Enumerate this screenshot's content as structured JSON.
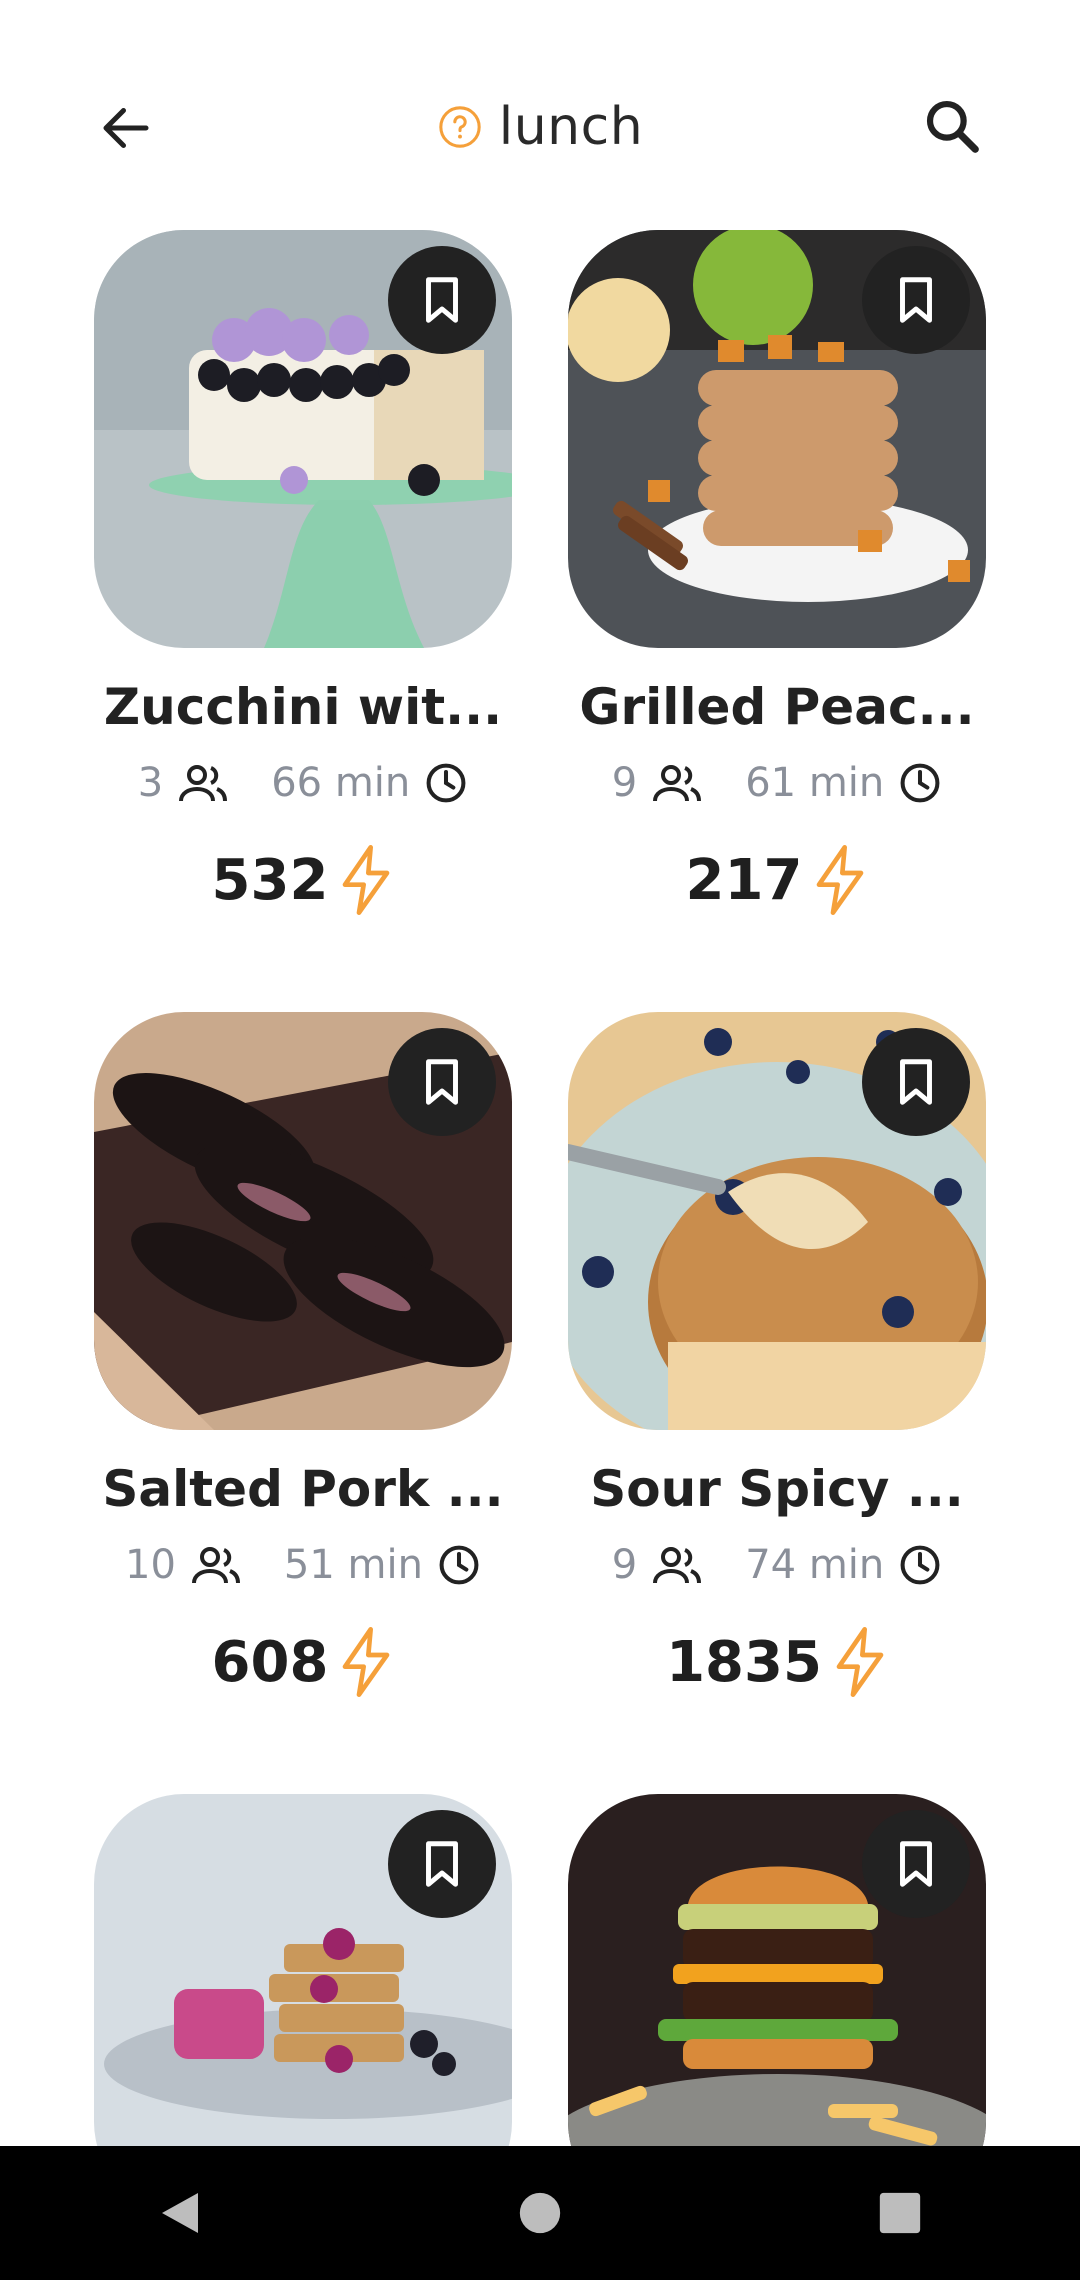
{
  "header": {
    "title": "lunch",
    "icons": {
      "back": "arrow-left-icon",
      "help": "help-circle-icon",
      "search": "search-icon"
    },
    "accent_color": "#F5A03A"
  },
  "recipes": [
    {
      "title": "Zucchini wit...",
      "servings": "3",
      "time": "66 min",
      "energy": "532"
    },
    {
      "title": "Grilled Peac...",
      "servings": "9",
      "time": "61 min",
      "energy": "217"
    },
    {
      "title": "Salted Pork ...",
      "servings": "10",
      "time": "51 min",
      "energy": "608"
    },
    {
      "title": "Sour Spicy ...",
      "servings": "9",
      "time": "74 min",
      "energy": "1835"
    },
    {
      "title": "",
      "servings": "",
      "time": "",
      "energy": ""
    },
    {
      "title": "",
      "servings": "",
      "time": "",
      "energy": ""
    }
  ],
  "card_icons": {
    "bookmark": "bookmark-icon",
    "people": "people-icon",
    "clock": "clock-icon",
    "energy": "lightning-icon"
  },
  "nav": {
    "back": "triangle-back-icon",
    "home": "circle-home-icon",
    "recents": "square-recents-icon"
  }
}
